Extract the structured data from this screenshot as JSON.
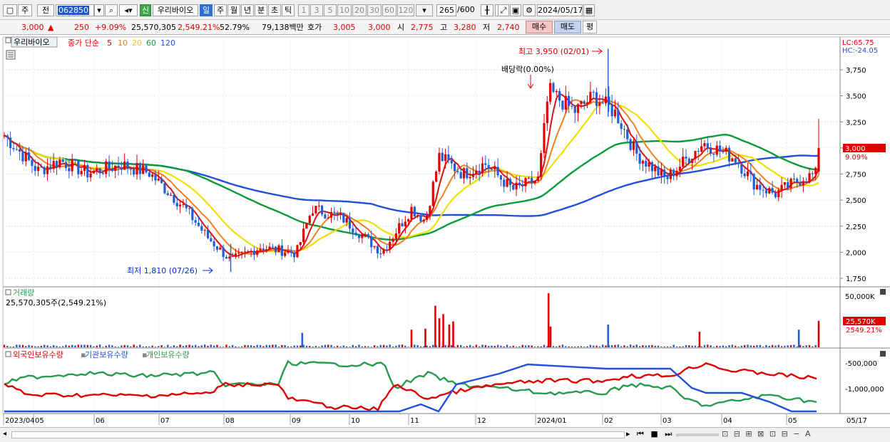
{
  "toolbar": {
    "period_labels": [
      "주",
      "전"
    ],
    "stock_code": "062850",
    "badge": "신",
    "stock_name": "우리바이오",
    "tabs": [
      "일",
      "주",
      "월",
      "년",
      "분",
      "초",
      "틱"
    ],
    "active_tab": "일",
    "intervals": [
      "1",
      "3",
      "5",
      "10",
      "20",
      "30",
      "60",
      "120"
    ],
    "count": "265",
    "total": "/600",
    "date": "2024/05/17"
  },
  "quote": {
    "price": "3,000",
    "arrow": "▲",
    "change": "250",
    "change_pct": "+9.09%",
    "volume": "25,570,305",
    "volume_ratio": "2,549.21%",
    "turnover": "52.79%",
    "amount": "79,138백만",
    "hoga_label": "호가",
    "ask": "3,005",
    "bid": "3,000",
    "open_label": "시",
    "open": "2,775",
    "high_label": "고",
    "high": "3,280",
    "low_label": "저",
    "low": "2,740",
    "buy": "매수",
    "sell": "매도",
    "avg": "평"
  },
  "price_panel": {
    "name_tag": "우리바이오",
    "ma_title": "종가 단순",
    "ma_periods": [
      "5",
      "10",
      "20",
      "60",
      "120"
    ],
    "lc": "LC:65.75",
    "hc": "HC:-24.05",
    "high_note": "최고 3,950 (02/01)",
    "low_note": "최저 1,810 (07/26)",
    "dividend_note": "배당락(0.00%)",
    "last_price": "3,000",
    "last_pct": "9.09%",
    "y_ticks": [
      "3,750",
      "3,500",
      "3,250",
      "3,000",
      "2,750",
      "2,500",
      "2,250",
      "2,000",
      "1,750"
    ]
  },
  "volume_panel": {
    "title": "거래량",
    "info": "25,570,305주(2,549.21%)",
    "y_tick": "50,000K",
    "last_value": "25,570K",
    "last_pct": "2549.21%"
  },
  "holdings_panel": {
    "titles": [
      "외국인보유수량",
      "기관보유수량",
      "개인보유수량"
    ],
    "y_ticks": [
      "-500,000",
      "-1,000,000"
    ]
  },
  "x_axis": [
    "2023/04",
    "05",
    "06",
    "07",
    "08",
    "09",
    "10",
    "11",
    "12",
    "2024/01",
    "02",
    "03",
    "04",
    "05",
    "05/17"
  ],
  "colors": {
    "up": "#e00000",
    "down": "#1f5fd8",
    "ma5": "#e01010",
    "ma10": "#f08020",
    "ma20": "#f0e000",
    "ma60": "#0a9a3a",
    "ma120": "#2050e0",
    "foreign": "#e00000",
    "institution": "#2050e0",
    "individual": "#2a9a50"
  },
  "chart_data": {
    "type": "candlestick",
    "price_axis": [
      1750,
      3750
    ],
    "price_anchors": [
      [
        "2023-04-03",
        3120
      ],
      [
        "2023-04-20",
        2780
      ],
      [
        "2023-05-01",
        2880
      ],
      [
        "2023-05-15",
        2760
      ],
      [
        "2023-06-01",
        2840
      ],
      [
        "2023-06-15",
        2760
      ],
      [
        "2023-07-03",
        2420
      ],
      [
        "2023-07-14",
        2150
      ],
      [
        "2023-07-26",
        1920
      ],
      [
        "2023-08-10",
        2050
      ],
      [
        "2023-08-28",
        1990
      ],
      [
        "2023-09-05",
        2420
      ],
      [
        "2023-09-20",
        2330
      ],
      [
        "2023-10-10",
        2000
      ],
      [
        "2023-10-25",
        2420
      ],
      [
        "2023-11-01",
        2300
      ],
      [
        "2023-11-08",
        2920
      ],
      [
        "2023-11-20",
        2750
      ],
      [
        "2023-12-01",
        2850
      ],
      [
        "2023-12-15",
        2600
      ],
      [
        "2023-12-28",
        2700
      ],
      [
        "2024-01-02",
        3550
      ],
      [
        "2024-01-15",
        3350
      ],
      [
        "2024-01-25",
        3500
      ],
      [
        "2024-02-05",
        3330
      ],
      [
        "2024-02-15",
        2950
      ],
      [
        "2024-03-01",
        2700
      ],
      [
        "2024-03-20",
        3050
      ],
      [
        "2024-04-05",
        2900
      ],
      [
        "2024-04-15",
        2650
      ],
      [
        "2024-04-25",
        2560
      ],
      [
        "2024-05-08",
        2700
      ],
      [
        "2024-05-16",
        2750
      ],
      [
        "2024-05-17",
        3000
      ]
    ],
    "last_candle": {
      "date": "2024-05-17",
      "open": 2775,
      "high": 3280,
      "low": 2740,
      "close": 3000,
      "volume": 25570305
    },
    "period_high": {
      "date": "2024-02-01",
      "value": 3950
    },
    "period_low": {
      "date": "2023-07-26",
      "value": 1810
    },
    "volume_axis_max_K": 50000
  }
}
